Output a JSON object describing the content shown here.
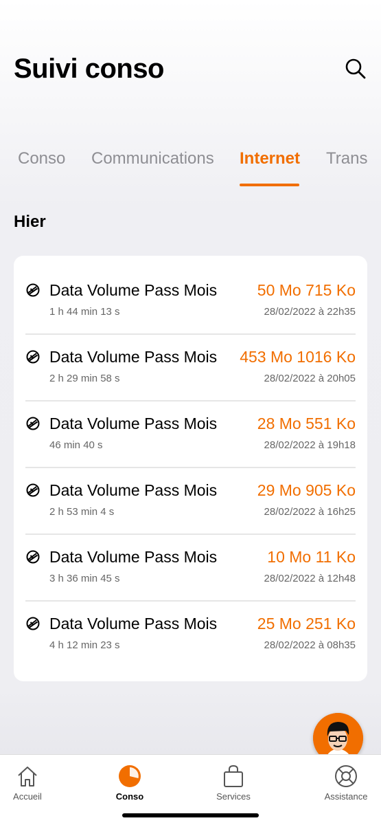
{
  "header": {
    "title": "Suivi conso",
    "search_icon": "search-icon"
  },
  "tabs": [
    {
      "label": "Conso",
      "active": false
    },
    {
      "label": "Communications",
      "active": false
    },
    {
      "label": "Internet",
      "active": true
    },
    {
      "label": "Trans",
      "active": false
    }
  ],
  "section": {
    "title": "Hier"
  },
  "rows": [
    {
      "title": "Data Volume Pass Mois",
      "duration": "1 h 44 min 13 s",
      "volume": "50 Mo 715 Ko",
      "date": "28/02/2022 à 22h35",
      "icon": "data-globe-icon"
    },
    {
      "title": "Data Volume Pass Mois",
      "duration": "2 h 29 min 58 s",
      "volume": "453 Mo 1016 Ko",
      "date": "28/02/2022 à 20h05",
      "icon": "data-globe-icon"
    },
    {
      "title": "Data Volume Pass Mois",
      "duration": "46 min 40 s",
      "volume": "28 Mo 551 Ko",
      "date": "28/02/2022 à 19h18",
      "icon": "data-globe-icon"
    },
    {
      "title": "Data Volume Pass Mois",
      "duration": "2 h 53 min 4 s",
      "volume": "29 Mo 905 Ko",
      "date": "28/02/2022 à 16h25",
      "icon": "data-globe-icon"
    },
    {
      "title": "Data Volume Pass Mois",
      "duration": "3 h 36 min 45 s",
      "volume": "10 Mo 11 Ko",
      "date": "28/02/2022 à 12h48",
      "icon": "data-globe-icon"
    },
    {
      "title": "Data Volume Pass Mois",
      "duration": "4 h 12 min 23 s",
      "volume": "25 Mo 251 Ko",
      "date": "28/02/2022 à 08h35",
      "icon": "data-globe-icon"
    }
  ],
  "tabbar": [
    {
      "label": "Accueil",
      "icon": "home-icon",
      "active": false
    },
    {
      "label": "Conso",
      "icon": "pie-chart-icon",
      "active": true
    },
    {
      "label": "Services",
      "icon": "shopping-bag-icon",
      "active": false
    },
    {
      "label": "Assistance",
      "icon": "lifebuoy-icon",
      "active": false
    }
  ],
  "colors": {
    "accent": "#f16e00",
    "background": "#eeeef2",
    "card": "#ffffff"
  }
}
